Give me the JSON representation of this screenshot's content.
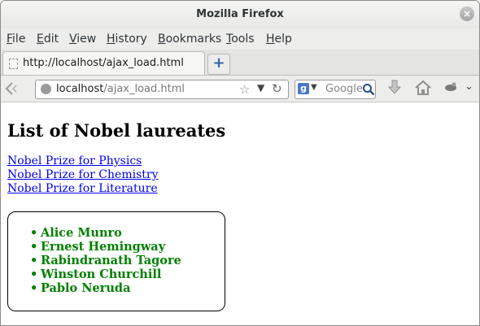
{
  "window": {
    "title": "Mozilla Firefox",
    "close_label": "×"
  },
  "menubar": {
    "items": [
      "File",
      "Edit",
      "View",
      "History",
      "Bookmarks",
      "Tools",
      "Help"
    ]
  },
  "tabs": [
    {
      "label": "http://localhost/ajax_load.html"
    }
  ],
  "newtab_label": "+",
  "navbar": {
    "url_host": "localhost",
    "url_path": "/ajax_load.html",
    "search_placeholder": "Google",
    "search_engine_letter": "g"
  },
  "page": {
    "heading": "List of Nobel laureates",
    "links": [
      "Nobel Prize for Physics",
      "Nobel Prize for Chemistry",
      "Nobel Prize for Literature"
    ],
    "laureates": [
      "Alice Munro",
      "Ernest Hemingway",
      "Rabindranath Tagore",
      "Winston Churchill",
      "Pablo Neruda"
    ]
  },
  "colors": {
    "link": "#0000ee",
    "laureate_text": "#008000"
  },
  "icons": [
    "back-icon",
    "globe-icon",
    "star-icon",
    "reload-icon",
    "search-icon",
    "download-icon",
    "home-icon",
    "extension-icon",
    "menu-chevron-icon"
  ]
}
